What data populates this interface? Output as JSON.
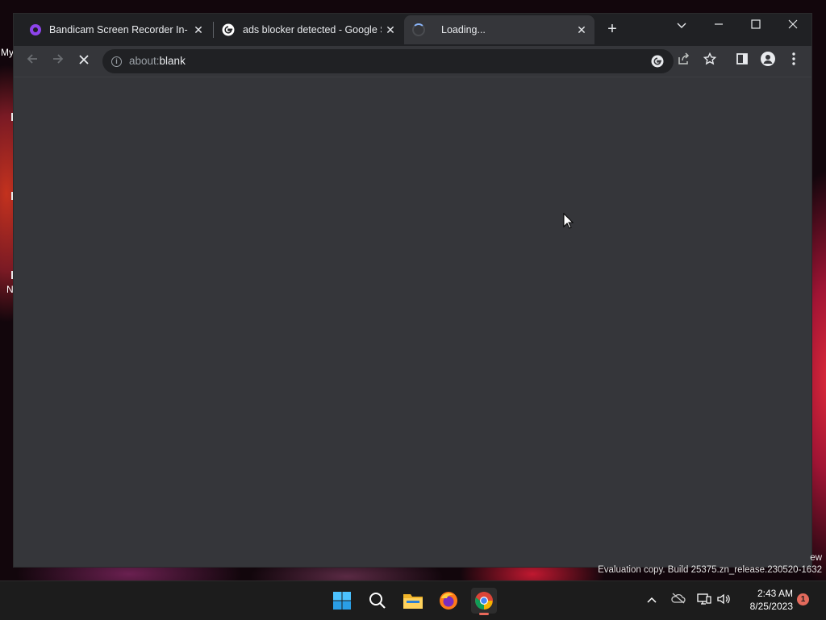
{
  "desktop": {
    "labels": [
      "My",
      "N"
    ]
  },
  "browser": {
    "tabs": [
      {
        "title": "Bandicam Screen Recorder In-de",
        "favicon": "bandicam-icon",
        "active": false
      },
      {
        "title": "ads blocker detected - Google Se",
        "favicon": "google-icon",
        "active": false
      },
      {
        "title": "Loading...",
        "favicon": "loading-spinner",
        "active": true
      }
    ],
    "new_tab_label": "+",
    "window_controls": [
      "tab-search",
      "minimize",
      "maximize",
      "close"
    ],
    "toolbar": {
      "url_scheme": "about:",
      "url_rest": "blank",
      "buttons": [
        "back",
        "forward",
        "stop",
        "google-lens",
        "share",
        "bookmark-star",
        "side-panel",
        "profile",
        "menu"
      ]
    }
  },
  "watermark": {
    "fragment": "ew",
    "text": "Evaluation copy. Build 25375.zn_release.230520-1632"
  },
  "taskbar": {
    "apps": [
      "windows-start",
      "search",
      "file-explorer",
      "firefox",
      "chrome"
    ],
    "active_app": "chrome",
    "clock_time": "2:43 AM",
    "clock_date": "8/25/2023",
    "notification_count": "1"
  },
  "colors": {
    "tabstrip": "#202124",
    "toolbar": "#35363a",
    "page": "#35363a",
    "taskbar": "#1c1c1c",
    "accent": "#8ab4f8"
  }
}
